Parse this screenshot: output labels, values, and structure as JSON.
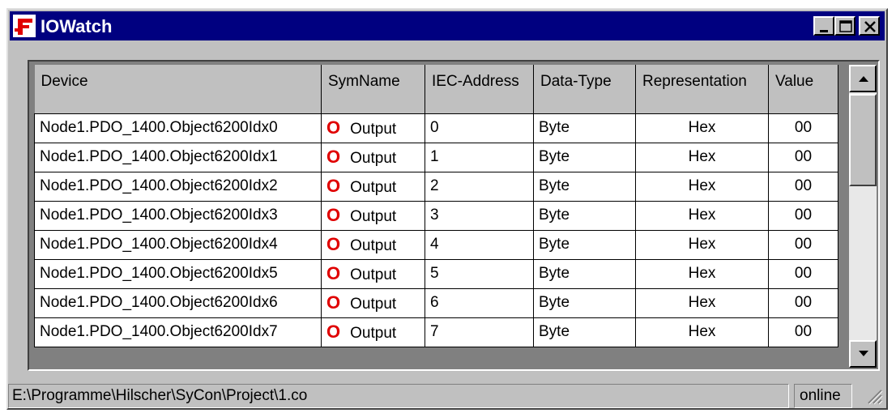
{
  "window": {
    "title": "IOWatch"
  },
  "columns": [
    "Device",
    "SymName",
    "IEC-Address",
    "Data-Type",
    "Representation",
    "Value"
  ],
  "rows": [
    {
      "device": "Node1.PDO_1400.Object6200Idx0",
      "io": "O",
      "symname": "Output",
      "address": "0",
      "type": "Byte",
      "repr": "Hex",
      "value": "00"
    },
    {
      "device": "Node1.PDO_1400.Object6200Idx1",
      "io": "O",
      "symname": "Output",
      "address": "1",
      "type": "Byte",
      "repr": "Hex",
      "value": "00"
    },
    {
      "device": "Node1.PDO_1400.Object6200Idx2",
      "io": "O",
      "symname": "Output",
      "address": "2",
      "type": "Byte",
      "repr": "Hex",
      "value": "00"
    },
    {
      "device": "Node1.PDO_1400.Object6200Idx3",
      "io": "O",
      "symname": "Output",
      "address": "3",
      "type": "Byte",
      "repr": "Hex",
      "value": "00"
    },
    {
      "device": "Node1.PDO_1400.Object6200Idx4",
      "io": "O",
      "symname": "Output",
      "address": "4",
      "type": "Byte",
      "repr": "Hex",
      "value": "00"
    },
    {
      "device": "Node1.PDO_1400.Object6200Idx5",
      "io": "O",
      "symname": "Output",
      "address": "5",
      "type": "Byte",
      "repr": "Hex",
      "value": "00"
    },
    {
      "device": "Node1.PDO_1400.Object6200Idx6",
      "io": "O",
      "symname": "Output",
      "address": "6",
      "type": "Byte",
      "repr": "Hex",
      "value": "00"
    },
    {
      "device": "Node1.PDO_1400.Object6200Idx7",
      "io": "O",
      "symname": "Output",
      "address": "7",
      "type": "Byte",
      "repr": "Hex",
      "value": "00"
    }
  ],
  "statusbar": {
    "path": "E:\\Programme\\Hilscher\\SyCon\\Project\\1.co",
    "mode": "online"
  },
  "icons": {
    "app": "sycon-app-icon",
    "minimize": "minimize-icon",
    "maximize": "maximize-icon",
    "close": "close-icon",
    "scroll_up": "arrow-up-icon",
    "scroll_down": "arrow-down-icon",
    "grip": "resize-grip-icon"
  },
  "colors": {
    "titlebar": "#000080",
    "io_mark": "#e00000",
    "face": "#c0c0c0"
  }
}
